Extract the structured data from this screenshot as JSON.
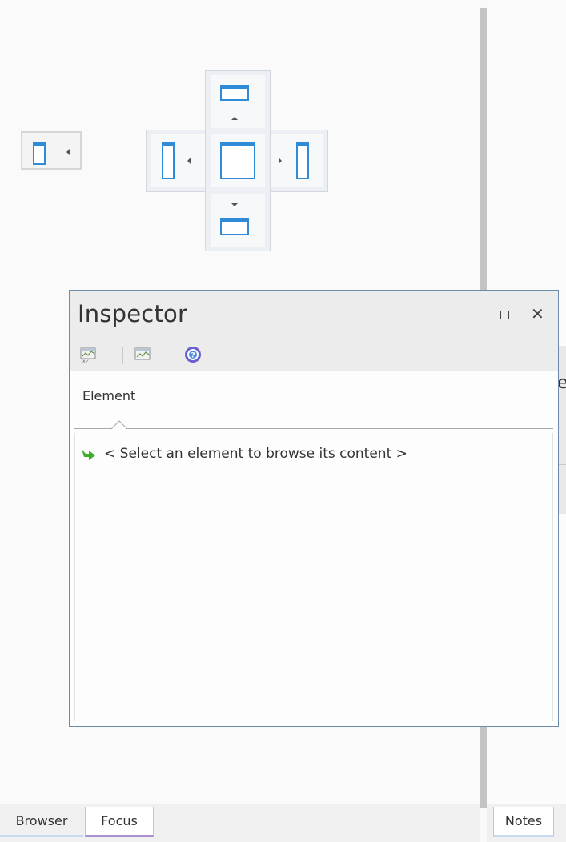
{
  "inspector": {
    "title": "Inspector",
    "toolbar_icons": [
      "element-props-icon",
      "diagram-props-icon",
      "help-icon"
    ],
    "tabs": [
      {
        "label": "Element"
      }
    ],
    "placeholder": "< Select an element to browse its content >",
    "placeholder_icon": "green-arrow-icon"
  },
  "docking_guide": {
    "targets": [
      "dock-left-outer",
      "dock-left",
      "dock-top",
      "dock-center",
      "dock-right",
      "dock-bottom"
    ]
  },
  "bottom_tabs": [
    {
      "label": "Browser"
    },
    {
      "label": "Focus"
    },
    {
      "label": "Notes"
    }
  ],
  "partial_text": {
    "right_pane_letter": "e"
  },
  "colors": {
    "dock_window_blue": "#2f8bd8",
    "focus_tab_underline": "#a98fd0",
    "window_border": "#6d8aa8"
  }
}
